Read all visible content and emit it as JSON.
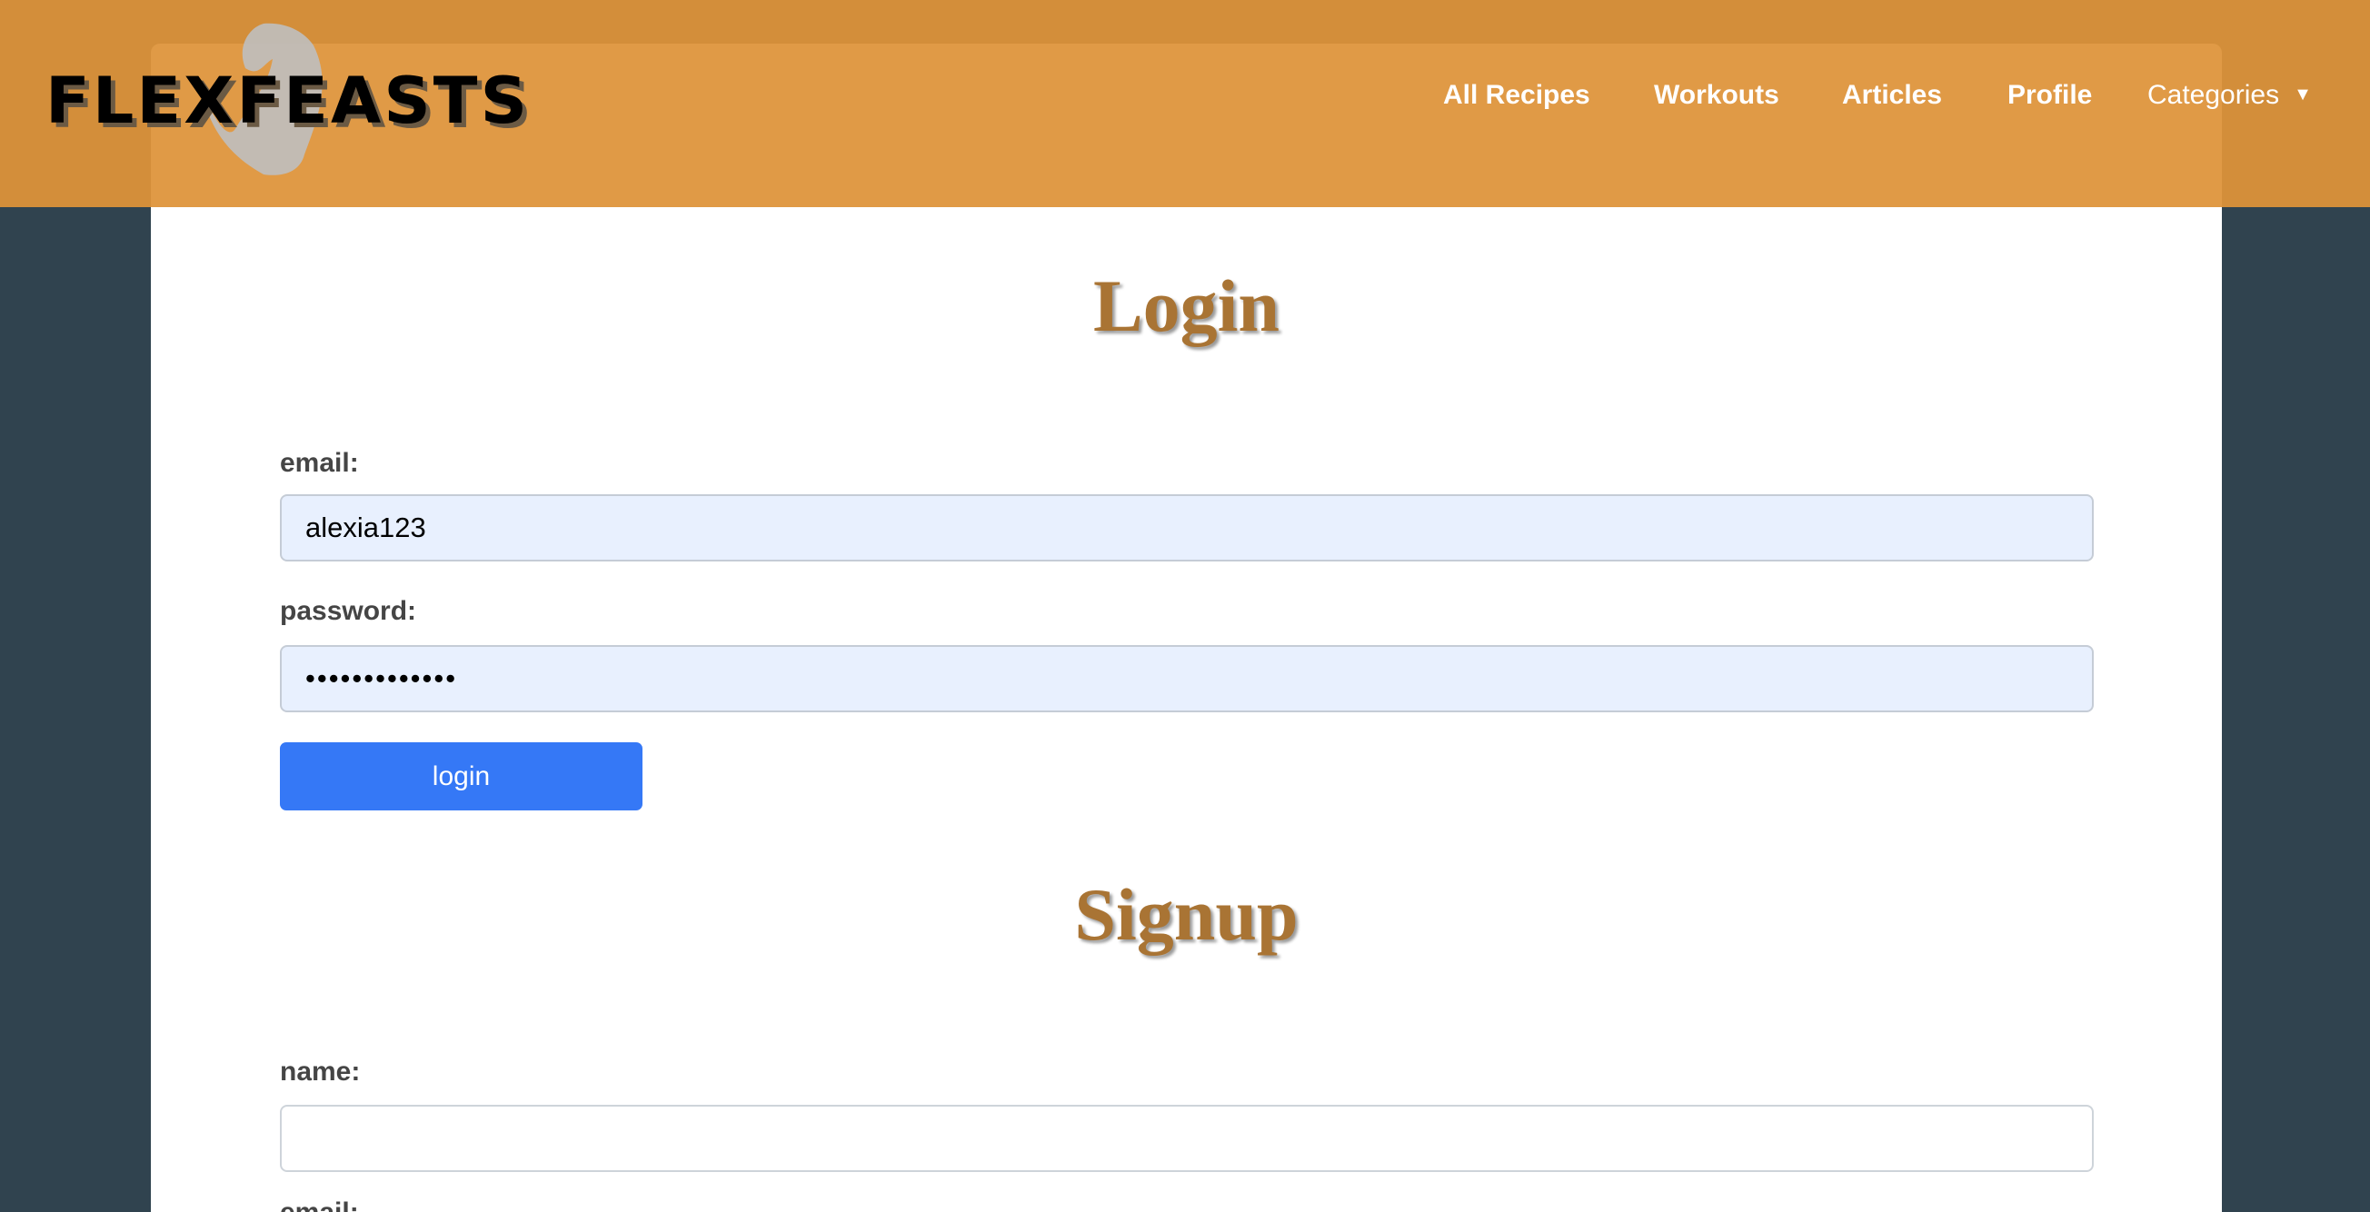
{
  "brand": {
    "name": "FLEXFEASTS"
  },
  "nav": {
    "items": [
      "All Recipes",
      "Workouts",
      "Articles",
      "Profile"
    ],
    "categories": "Categories"
  },
  "login": {
    "title": "Login",
    "email_label": "email:",
    "email_value": "alexia123",
    "password_label": "password:",
    "password_value": "•••••••••••••",
    "button": "login"
  },
  "signup": {
    "title": "Signup",
    "name_label": "name:",
    "name_value": "",
    "email_label": "email:"
  },
  "colors": {
    "header": "#d38e3a",
    "accent": "#a97434",
    "button": "#3578f6",
    "background": "#30434f"
  }
}
